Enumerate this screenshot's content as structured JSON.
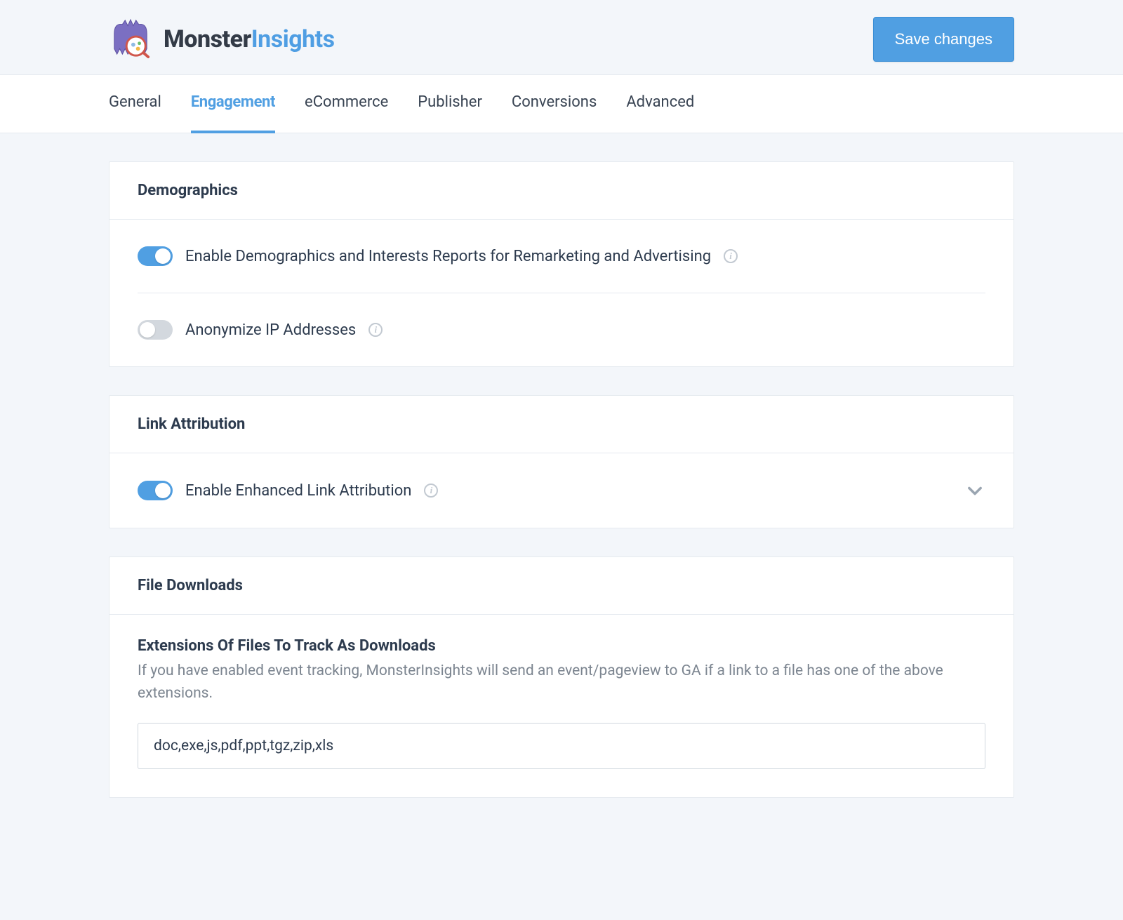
{
  "header": {
    "brand_primary": "Monster",
    "brand_secondary": "Insights",
    "save_label": "Save changes"
  },
  "tabs": [
    {
      "label": "General",
      "active": false
    },
    {
      "label": "Engagement",
      "active": true
    },
    {
      "label": "eCommerce",
      "active": false
    },
    {
      "label": "Publisher",
      "active": false
    },
    {
      "label": "Conversions",
      "active": false
    },
    {
      "label": "Advanced",
      "active": false
    }
  ],
  "panels": {
    "demographics": {
      "title": "Demographics",
      "rows": [
        {
          "label": "Enable Demographics and Interests Reports for Remarketing and Advertising",
          "on": true
        },
        {
          "label": "Anonymize IP Addresses",
          "on": false
        }
      ]
    },
    "link_attribution": {
      "title": "Link Attribution",
      "row": {
        "label": "Enable Enhanced Link Attribution",
        "on": true
      }
    },
    "file_downloads": {
      "title": "File Downloads",
      "field_heading": "Extensions Of Files To Track As Downloads",
      "field_help": "If you have enabled event tracking, MonsterInsights will send an event/pageview to GA if a link to a file has one of the above extensions.",
      "field_value": "doc,exe,js,pdf,ppt,tgz,zip,xls"
    }
  }
}
